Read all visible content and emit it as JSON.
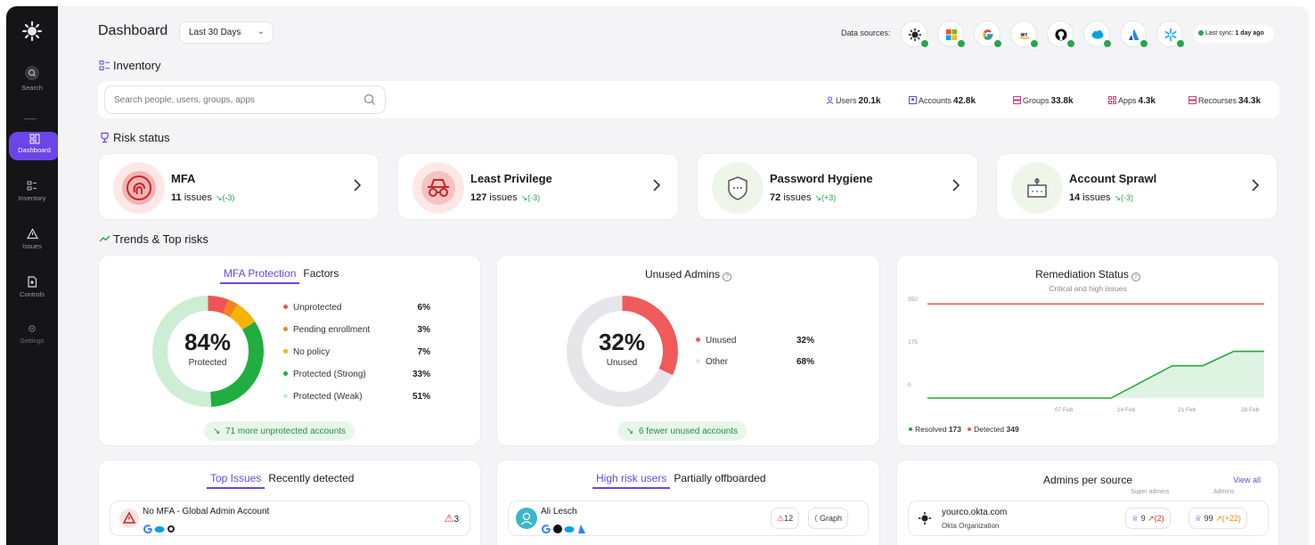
{
  "sidebar": {
    "items": [
      {
        "label": "Search",
        "icon": "search-icon"
      },
      {
        "label": "Dashboard",
        "icon": "dashboard-icon"
      },
      {
        "label": "Inventory",
        "icon": "inventory-icon"
      },
      {
        "label": "Issues",
        "icon": "warning-icon"
      },
      {
        "label": "Controls",
        "icon": "controls-icon"
      },
      {
        "label": "Settings",
        "icon": "gear-icon"
      }
    ]
  },
  "header": {
    "title": "Dashboard",
    "range": "Last 30 Days",
    "data_sources_label": "Data sources:",
    "sources": [
      "okta-icon",
      "microsoft-icon",
      "google-icon",
      "aws-icon",
      "github-icon",
      "salesforce-icon",
      "atlassian-icon",
      "snowflake-icon"
    ],
    "last_sync_label": "Last sync:",
    "last_sync_value": "1 day ago"
  },
  "inventory": {
    "title": "Inventory",
    "search_placeholder": "Search people, users, groups, apps",
    "stats": [
      {
        "label": "Users",
        "value": "20.1k"
      },
      {
        "label": "Accounts",
        "value": "42.8k"
      },
      {
        "label": "Groups",
        "value": "33.8k"
      },
      {
        "label": "Apps",
        "value": "4.3k"
      },
      {
        "label": "Recourses",
        "value": "34.3k"
      }
    ]
  },
  "risk": {
    "title": "Risk status",
    "cards": [
      {
        "name": "MFA",
        "count": "11",
        "issues_word": "issues",
        "delta": "(-3)"
      },
      {
        "name": "Least Privilege",
        "count": "127",
        "issues_word": "issues",
        "delta": "(-3)"
      },
      {
        "name": "Password Hygiene",
        "count": "72",
        "issues_word": "issues",
        "delta": "(+3)"
      },
      {
        "name": "Account Sprawl",
        "count": "14",
        "issues_word": "issues",
        "delta": "(-3)"
      }
    ]
  },
  "trends": {
    "title": "Trends & Top risks",
    "mfa": {
      "tabs": [
        "MFA Protection",
        "Factors"
      ],
      "center_value": "84%",
      "center_label": "Protected",
      "legend": [
        {
          "label": "Unprotected",
          "pct": "6%",
          "color": "#f05454"
        },
        {
          "label": "Pending enrollment",
          "pct": "3%",
          "color": "#f5821f"
        },
        {
          "label": "No policy",
          "pct": "7%",
          "color": "#f5b400"
        },
        {
          "label": "Protected (Strong)",
          "pct": "33%",
          "color": "#1fae3f"
        },
        {
          "label": "Protected (Weak)",
          "pct": "51%",
          "color": "#cdeed3"
        }
      ],
      "pill": "71 more unprotected accounts"
    },
    "unused": {
      "title": "Unused Admins",
      "center_value": "32%",
      "center_label": "Unused",
      "legend": [
        {
          "label": "Unused",
          "pct": "32%",
          "color": "#f05a5a"
        },
        {
          "label": "Other",
          "pct": "68%",
          "color": "#e6e6ea"
        }
      ],
      "pill": "6 fewer unused accounts"
    },
    "remediation": {
      "title": "Remediation Status",
      "subtitle": "Critical and high issues",
      "y_ticks": [
        "350",
        "175",
        "0"
      ],
      "x_ticks": [
        "07 Feb",
        "14 Feb",
        "21 Feb",
        "28 Feb"
      ],
      "legend": [
        {
          "label": "Resolved",
          "value": "173",
          "color": "#1fae3f"
        },
        {
          "label": "Detected",
          "value": "349",
          "color": "#f05454"
        }
      ]
    }
  },
  "chart_data": {
    "type": "line",
    "title": "Remediation Status",
    "subtitle": "Critical and high issues",
    "ylim": [
      0,
      350
    ],
    "x_ticks": [
      "07 Feb",
      "14 Feb",
      "21 Feb",
      "28 Feb"
    ],
    "series": [
      {
        "name": "Detected",
        "color": "#f05454",
        "values": [
          349,
          349,
          349,
          349,
          349,
          349,
          349,
          349,
          349,
          349,
          349,
          349
        ]
      },
      {
        "name": "Resolved",
        "color": "#1fae3f",
        "values": [
          0,
          0,
          0,
          0,
          0,
          0,
          0,
          60,
          120,
          120,
          173,
          173
        ]
      }
    ]
  },
  "bottom": {
    "issues": {
      "tabs": [
        "Top Issues",
        "Recently detected"
      ],
      "row_title": "No MFA - Global Admin Account",
      "row_count": "3"
    },
    "users": {
      "tabs": [
        "High risk users",
        "Partially offboarded"
      ],
      "name": "Ali Lesch",
      "count": "12",
      "graph_label": "Graph"
    },
    "admins": {
      "title": "Admins per source",
      "view_all": "View all",
      "col_super": "Super admins",
      "col_admins": "Admins",
      "source_name": "yourco.okta.com",
      "source_type": "Okta Organization",
      "super_count": "9",
      "super_delta": "(2)",
      "admin_count": "99",
      "admin_delta": "(+22)"
    }
  }
}
